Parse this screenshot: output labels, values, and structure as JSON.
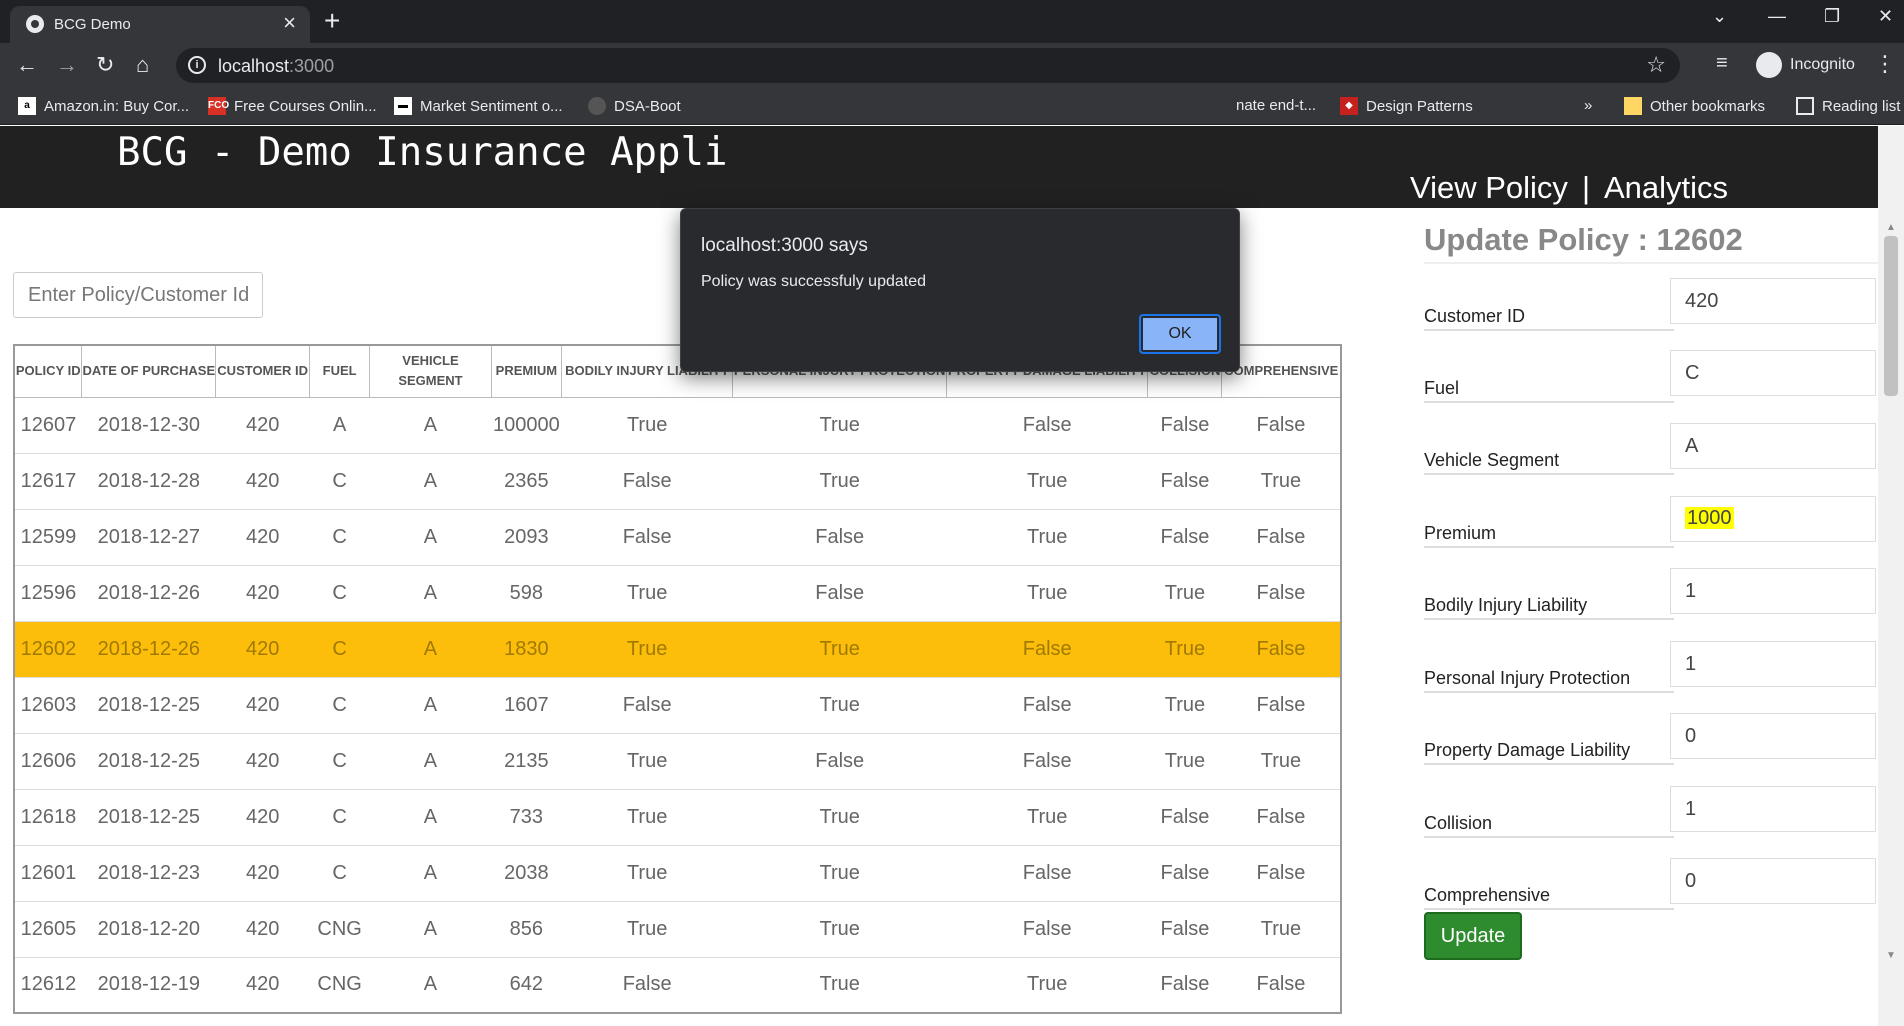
{
  "browser": {
    "tab_title": "BCG Demo",
    "url_host": "localhost",
    "url_port": ":3000",
    "profile_label": "Incognito",
    "bookmarks": [
      {
        "label": "Amazon.in: Buy Cor...",
        "icon": "amazon-icon"
      },
      {
        "label": "Free Courses Onlin...",
        "icon": "fco-icon"
      },
      {
        "label": "Market Sentiment o...",
        "icon": "market-icon"
      },
      {
        "label": "DSA-Boot",
        "icon": "github-icon"
      },
      {
        "label": "nate end-t...",
        "icon": "page-icon"
      },
      {
        "label": "Design Patterns",
        "icon": "design-patterns-icon"
      }
    ],
    "bookmarks_overflow": "»",
    "other_bookmarks": "Other bookmarks",
    "reading_list": "Reading list"
  },
  "app": {
    "title": "BCG - Demo Insurance Appli",
    "nav": {
      "view_policy": "View Policy",
      "separator": "|",
      "analytics": "Analytics"
    }
  },
  "search": {
    "placeholder": "Enter Policy/Customer Id"
  },
  "table": {
    "headers": [
      "POLICY ID",
      "DATE OF PURCHASE",
      "CUSTOMER ID",
      "FUEL",
      "VEHICLE SEGMENT",
      "PREMIUM",
      "BODILY INJURY LIABILITY",
      "PERSONAL INJURY PROTECTION",
      "PROPERTY DAMAGE LIABILITY",
      "COLLISION",
      "COMPREHENSIVE"
    ],
    "highlighted_row": 4,
    "rows": [
      [
        "12607",
        "2018-12-30",
        "420",
        "A",
        "A",
        "100000",
        "True",
        "True",
        "False",
        "False",
        "False"
      ],
      [
        "12617",
        "2018-12-28",
        "420",
        "C",
        "A",
        "2365",
        "False",
        "True",
        "True",
        "False",
        "True"
      ],
      [
        "12599",
        "2018-12-27",
        "420",
        "C",
        "A",
        "2093",
        "False",
        "False",
        "True",
        "False",
        "False"
      ],
      [
        "12596",
        "2018-12-26",
        "420",
        "C",
        "A",
        "598",
        "True",
        "False",
        "True",
        "True",
        "False"
      ],
      [
        "12602",
        "2018-12-26",
        "420",
        "C",
        "A",
        "1830",
        "True",
        "True",
        "False",
        "True",
        "False"
      ],
      [
        "12603",
        "2018-12-25",
        "420",
        "C",
        "A",
        "1607",
        "False",
        "True",
        "False",
        "True",
        "False"
      ],
      [
        "12606",
        "2018-12-25",
        "420",
        "C",
        "A",
        "2135",
        "True",
        "False",
        "False",
        "True",
        "True"
      ],
      [
        "12618",
        "2018-12-25",
        "420",
        "C",
        "A",
        "733",
        "True",
        "True",
        "True",
        "False",
        "False"
      ],
      [
        "12601",
        "2018-12-23",
        "420",
        "C",
        "A",
        "2038",
        "True",
        "True",
        "False",
        "False",
        "False"
      ],
      [
        "12605",
        "2018-12-20",
        "420",
        "CNG",
        "A",
        "856",
        "True",
        "True",
        "False",
        "False",
        "True"
      ],
      [
        "12612",
        "2018-12-19",
        "420",
        "CNG",
        "A",
        "642",
        "False",
        "True",
        "True",
        "False",
        "False"
      ]
    ]
  },
  "update_panel": {
    "title": "Update Policy : 12602",
    "fields": [
      {
        "label": "Customer ID",
        "value": "420"
      },
      {
        "label": "Fuel",
        "value": "C"
      },
      {
        "label": "Vehicle Segment",
        "value": "A"
      },
      {
        "label": "Premium",
        "value": "1000"
      },
      {
        "label": "Bodily Injury Liability",
        "value": "1"
      },
      {
        "label": "Personal Injury Protection",
        "value": "1"
      },
      {
        "label": "Property Damage Liability",
        "value": "0"
      },
      {
        "label": "Collision",
        "value": "1"
      },
      {
        "label": "Comprehensive",
        "value": "0"
      }
    ],
    "button_label": "Update"
  },
  "dialog": {
    "title": "localhost:3000 says",
    "message": "Policy was successfuly updated",
    "ok_label": "OK"
  },
  "colors": {
    "highlight_row": "#fcbd0b",
    "header_bg": "#212121",
    "update_button": "#2e8b2e",
    "dialog_bg": "#292a2d",
    "ok_button": "#8ab4f8"
  }
}
